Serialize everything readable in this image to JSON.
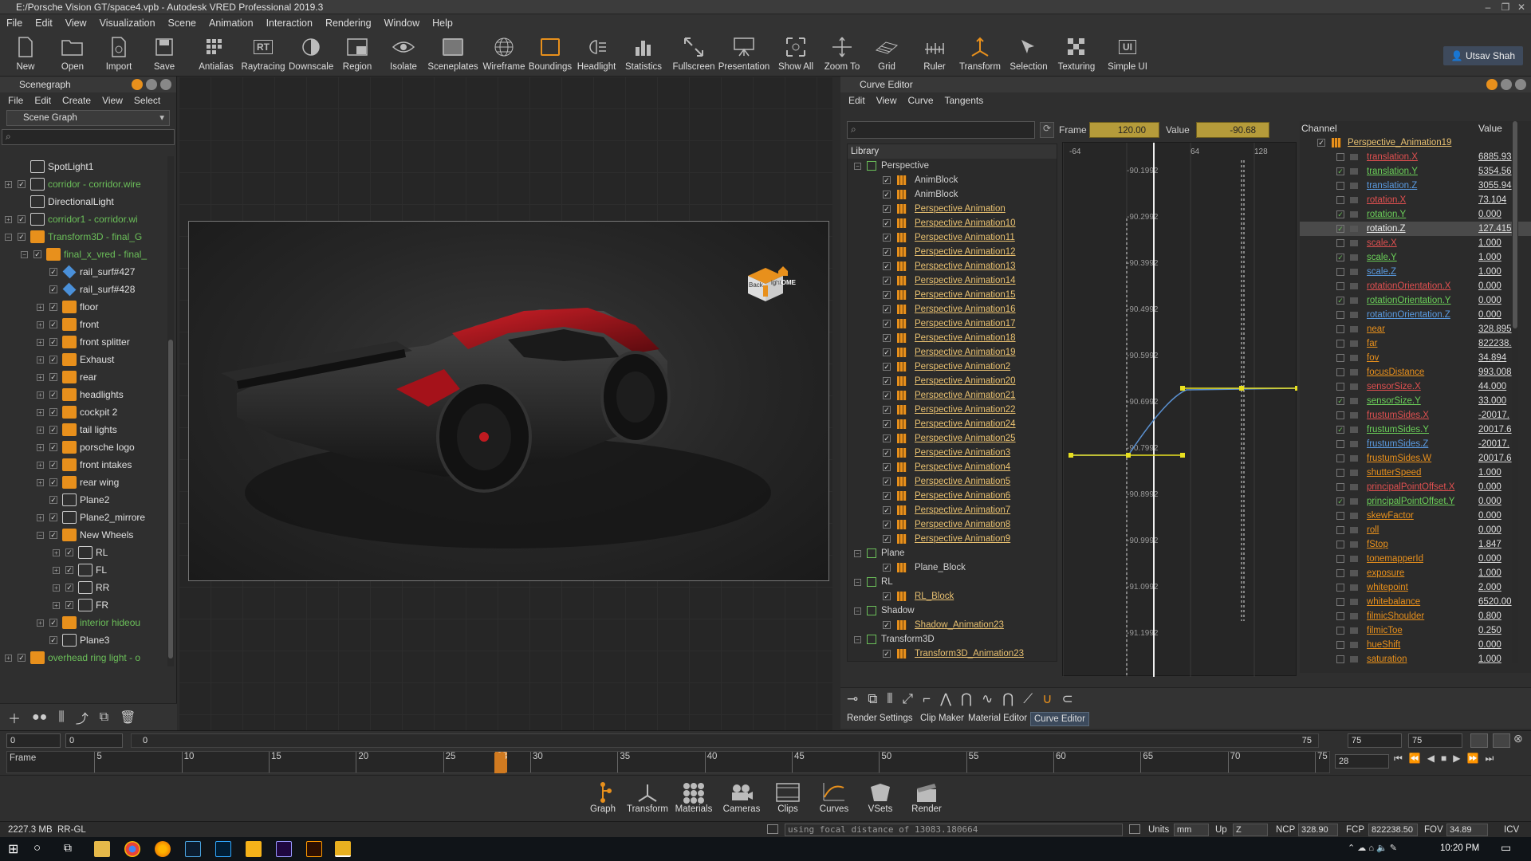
{
  "window": {
    "title": "E:/Porsche Vision GT/space4.vpb - Autodesk VRED Professional 2019.3"
  },
  "menu": [
    "File",
    "Edit",
    "View",
    "Visualization",
    "Scene",
    "Animation",
    "Interaction",
    "Rendering",
    "Window",
    "Help"
  ],
  "toolbar": [
    "New",
    "Open",
    "Import",
    "Save",
    "Antialias",
    "Raytracing",
    "Downscale",
    "Region",
    "Isolate",
    "Sceneplates",
    "Wireframe",
    "Boundings",
    "Headlight",
    "Statistics",
    "Fullscreen",
    "Presentation",
    "Show All",
    "Zoom To",
    "Grid",
    "Ruler",
    "Transform",
    "Selection",
    "Texturing",
    "Simple UI"
  ],
  "toolbar_icon_text": {
    "raytracing": "RT",
    "simple_ui": "UI"
  },
  "user": {
    "name": "Utsav Shah"
  },
  "scenegraph": {
    "title": "Scenegraph",
    "menu": [
      "File",
      "Edit",
      "Create",
      "View",
      "Select"
    ],
    "mode": "Scene Graph",
    "items": [
      {
        "label": "SpotLight1",
        "green": false
      },
      {
        "label": "corridor - corridor.wire",
        "green": true
      },
      {
        "label": "DirectionalLight",
        "green": false
      },
      {
        "label": "corridor1 - corridor.wi",
        "green": true
      },
      {
        "label": "Transform3D - final_G",
        "green": true
      },
      {
        "label": "final_x_vred - final_",
        "green": true
      },
      {
        "label": "rail_surf#427",
        "green": false
      },
      {
        "label": "rail_surf#428",
        "green": false
      },
      {
        "label": "floor",
        "green": false
      },
      {
        "label": "front",
        "green": false
      },
      {
        "label": "front splitter",
        "green": false
      },
      {
        "label": "Exhaust",
        "green": false
      },
      {
        "label": "rear",
        "green": false
      },
      {
        "label": "headlights",
        "green": false
      },
      {
        "label": "cockpit 2",
        "green": false
      },
      {
        "label": "tail lights",
        "green": false
      },
      {
        "label": "porsche logo",
        "green": false
      },
      {
        "label": "front intakes",
        "green": false
      },
      {
        "label": "rear wing",
        "green": false
      },
      {
        "label": "Plane2",
        "green": false
      },
      {
        "label": "Plane2_mirrore",
        "green": false
      },
      {
        "label": "New Wheels",
        "green": false
      },
      {
        "label": "RL",
        "green": false
      },
      {
        "label": "FL",
        "green": false
      },
      {
        "label": "RR",
        "green": false
      },
      {
        "label": "FR",
        "green": false
      },
      {
        "label": "interior hideou",
        "green": true
      },
      {
        "label": "Plane3",
        "green": false
      },
      {
        "label": "overhead ring light - o",
        "green": true
      }
    ]
  },
  "viewport": {
    "navcube_label": "HOME",
    "navcube_faces": [
      "Back",
      "ight"
    ]
  },
  "curve_editor": {
    "title": "Curve Editor",
    "menu": [
      "Edit",
      "View",
      "Curve",
      "Tangents"
    ],
    "frame_label": "Frame",
    "frame_value": "120.00",
    "value_label": "Value",
    "value_value": "-90.68",
    "library_label": "Library",
    "library": [
      {
        "label": "Perspective",
        "group": true
      },
      {
        "label": "AnimBlock",
        "link": false
      },
      {
        "label": "AnimBlock",
        "link": false
      },
      {
        "label": "Perspective Animation",
        "link": true
      },
      {
        "label": "Perspective Animation10",
        "link": true
      },
      {
        "label": "Perspective Animation11",
        "link": true
      },
      {
        "label": "Perspective Animation12",
        "link": true
      },
      {
        "label": "Perspective Animation13",
        "link": true
      },
      {
        "label": "Perspective Animation14",
        "link": true
      },
      {
        "label": "Perspective Animation15",
        "link": true
      },
      {
        "label": "Perspective Animation16",
        "link": true
      },
      {
        "label": "Perspective Animation17",
        "link": true
      },
      {
        "label": "Perspective Animation18",
        "link": true
      },
      {
        "label": "Perspective Animation19",
        "link": true
      },
      {
        "label": "Perspective Animation2",
        "link": true
      },
      {
        "label": "Perspective Animation20",
        "link": true
      },
      {
        "label": "Perspective Animation21",
        "link": true
      },
      {
        "label": "Perspective Animation22",
        "link": true
      },
      {
        "label": "Perspective Animation24",
        "link": true
      },
      {
        "label": "Perspective Animation25",
        "link": true
      },
      {
        "label": "Perspective Animation3",
        "link": true
      },
      {
        "label": "Perspective Animation4",
        "link": true
      },
      {
        "label": "Perspective Animation5",
        "link": true
      },
      {
        "label": "Perspective Animation6",
        "link": true
      },
      {
        "label": "Perspective Animation7",
        "link": true
      },
      {
        "label": "Perspective Animation8",
        "link": true
      },
      {
        "label": "Perspective Animation9",
        "link": true
      },
      {
        "label": "Plane",
        "group": true
      },
      {
        "label": "Plane_Block",
        "link": false
      },
      {
        "label": "RL",
        "group": true
      },
      {
        "label": "RL_Block",
        "link": true
      },
      {
        "label": "Shadow",
        "group": true
      },
      {
        "label": "Shadow_Animation23",
        "link": true
      },
      {
        "label": "Transform3D",
        "group": true
      },
      {
        "label": "Transform3D_Animation23",
        "link": true
      }
    ],
    "graph": {
      "x_ticks": [
        "-64",
        "64",
        "128"
      ],
      "y_ticks": [
        "-90.1992",
        "-90.2992",
        "-90.3992",
        "-90.4992",
        "-90.5992",
        "-90.6992",
        "-90.7992",
        "-90.8992",
        "-90.9992",
        "-91.0992",
        "-91.1992"
      ]
    },
    "channel_header": "Channel",
    "value_header": "Value",
    "channel_root": "Perspective_Animation19",
    "channels": [
      {
        "name": "translation.X",
        "value": "6885.93",
        "color": "red",
        "checked": false
      },
      {
        "name": "translation.Y",
        "value": "5354.56",
        "color": "green",
        "checked": true
      },
      {
        "name": "translation.Z",
        "value": "3055.94",
        "color": "blue",
        "checked": false
      },
      {
        "name": "rotation.X",
        "value": "73.104",
        "color": "red",
        "checked": false
      },
      {
        "name": "rotation.Y",
        "value": "0.000",
        "color": "green",
        "checked": true
      },
      {
        "name": "rotation.Z",
        "value": "127.415",
        "color": "white",
        "checked": true,
        "selected": true
      },
      {
        "name": "scale.X",
        "value": "1.000",
        "color": "red",
        "checked": false
      },
      {
        "name": "scale.Y",
        "value": "1.000",
        "color": "green",
        "checked": true
      },
      {
        "name": "scale.Z",
        "value": "1.000",
        "color": "blue",
        "checked": false
      },
      {
        "name": "rotationOrientation.X",
        "value": "0.000",
        "color": "red",
        "checked": false
      },
      {
        "name": "rotationOrientation.Y",
        "value": "0.000",
        "color": "green",
        "checked": true
      },
      {
        "name": "rotationOrientation.Z",
        "value": "0.000",
        "color": "blue",
        "checked": false
      },
      {
        "name": "near",
        "value": "328.895",
        "color": "orange",
        "checked": false
      },
      {
        "name": "far",
        "value": "822238.",
        "color": "orange",
        "checked": false
      },
      {
        "name": "fov",
        "value": "34.894",
        "color": "orange",
        "checked": false
      },
      {
        "name": "focusDistance",
        "value": "993.008",
        "color": "orange",
        "checked": false
      },
      {
        "name": "sensorSize.X",
        "value": "44.000",
        "color": "red",
        "checked": false
      },
      {
        "name": "sensorSize.Y",
        "value": "33.000",
        "color": "green",
        "checked": true
      },
      {
        "name": "frustumSides.X",
        "value": "-20017.",
        "color": "red",
        "checked": false
      },
      {
        "name": "frustumSides.Y",
        "value": "20017.6",
        "color": "green",
        "checked": true
      },
      {
        "name": "frustumSides.Z",
        "value": "-20017.",
        "color": "blue",
        "checked": false
      },
      {
        "name": "frustumSides.W",
        "value": "20017.6",
        "color": "orange",
        "checked": false
      },
      {
        "name": "shutterSpeed",
        "value": "1.000",
        "color": "orange",
        "checked": false
      },
      {
        "name": "principalPointOffset.X",
        "value": "0.000",
        "color": "red",
        "checked": false
      },
      {
        "name": "principalPointOffset.Y",
        "value": "0.000",
        "color": "green",
        "checked": true
      },
      {
        "name": "skewFactor",
        "value": "0.000",
        "color": "orange",
        "checked": false
      },
      {
        "name": "roll",
        "value": "0.000",
        "color": "orange",
        "checked": false
      },
      {
        "name": "fStop",
        "value": "1.847",
        "color": "orange",
        "checked": false
      },
      {
        "name": "tonemapperId",
        "value": "0.000",
        "color": "orange",
        "checked": false
      },
      {
        "name": "exposure",
        "value": "1.000",
        "color": "orange",
        "checked": false
      },
      {
        "name": "whitepoint",
        "value": "2.000",
        "color": "orange",
        "checked": false
      },
      {
        "name": "whitebalance",
        "value": "6520.00",
        "color": "orange",
        "checked": false
      },
      {
        "name": "filmicShoulder",
        "value": "0.800",
        "color": "orange",
        "checked": false
      },
      {
        "name": "filmicToe",
        "value": "0.250",
        "color": "orange",
        "checked": false
      },
      {
        "name": "hueShift",
        "value": "0.000",
        "color": "orange",
        "checked": false
      },
      {
        "name": "saturation",
        "value": "1.000",
        "color": "orange",
        "checked": false
      }
    ],
    "bottom_tabs": [
      "Render Settings",
      "Clip Maker",
      "Material Editor",
      "Curve Editor"
    ],
    "active_tab": "Curve Editor"
  },
  "timeline": {
    "start": "0",
    "field2": "0",
    "field3": "0",
    "end_display": "75",
    "end1": "75",
    "end2": "75",
    "current": "28",
    "frame_label": "Frame",
    "ticks": [
      "5",
      "10",
      "15",
      "20",
      "25",
      "28",
      "30",
      "35",
      "40",
      "45",
      "50",
      "55",
      "60",
      "65",
      "70",
      "75"
    ]
  },
  "dock": [
    "Graph",
    "Transform",
    "Materials",
    "Cameras",
    "Clips",
    "Curves",
    "VSets",
    "Render"
  ],
  "status": {
    "memory": "2227.3 MB",
    "renderer": "RR-GL",
    "message": "using focal distance of 13083.180664",
    "units_label": "Units",
    "units": "mm",
    "up_label": "Up",
    "up": "Z",
    "ncp_label": "NCP",
    "ncp": "328.90",
    "fcp_label": "FCP",
    "fcp": "822238.50",
    "fov_label": "FOV",
    "fov": "34.89",
    "icv": "ICV"
  },
  "taskbar": {
    "time": "10:20 PM"
  },
  "colors": {
    "accent": "#e8901c",
    "tree_green": "#6bbf59",
    "curve_yellow": "#e8e020",
    "car_red": "#b3151c"
  }
}
